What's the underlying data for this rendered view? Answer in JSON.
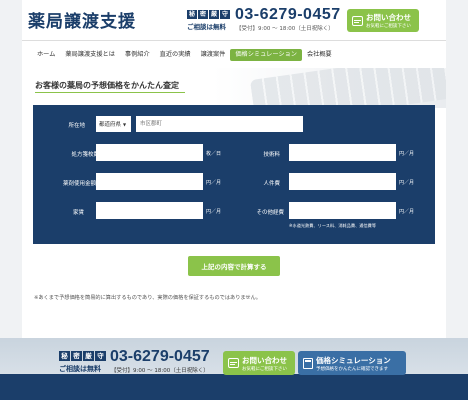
{
  "header": {
    "logo": "薬局譲渡支援",
    "secret_chars": [
      "秘",
      "密",
      "厳",
      "守"
    ],
    "free_consult": "ご相談は無料",
    "tel": "03-6279-0457",
    "hours": "【受付】9:00 〜 18:00（土日祝除く）",
    "contact_label": "お問い合わせ",
    "contact_sub": "お気軽にご相談下さい"
  },
  "nav": {
    "items": [
      {
        "label": "ホーム"
      },
      {
        "label": "薬局譲渡支援とは"
      },
      {
        "label": "事例紹介"
      },
      {
        "label": "直近の実績"
      },
      {
        "label": "譲渡案件"
      },
      {
        "label": "価格シミュレーション",
        "active": true
      },
      {
        "label": "会社概要"
      }
    ]
  },
  "section_title": "お客様の薬局の予想価格をかんたん査定",
  "form": {
    "location_label": "所在地",
    "prefecture_value": "都道府県",
    "city_placeholder": "市区郡町",
    "rx_label": "処方箋枚数",
    "rx_unit": "枚／日",
    "rent_label": "家賃",
    "rent_unit": "円／月",
    "drug_label": "薬剤使用金額",
    "drug_unit": "円／月",
    "labor_label": "人件費",
    "labor_unit": "円／月",
    "tech_label": "技術料",
    "tech_unit": "円／月",
    "other_label": "その他経費",
    "other_unit": "円／月",
    "other_note": "※水道光熱費、リース料、消耗品費、通信費等",
    "submit_label": "上記の内容で計算する"
  },
  "disclaimer": "※あくまで予想価格を簡易的に算出するものであり、実際の価格を保証するものではありません。",
  "footer": {
    "secret_chars": [
      "秘",
      "密",
      "厳",
      "守"
    ],
    "free_consult": "ご相談は無料",
    "tel": "03-6279-0457",
    "hours": "【受付】9:00 〜 18:00（土日祝除く）",
    "contact_label": "お問い合わせ",
    "contact_sub": "お気軽にご相談下さい",
    "sim_label": "価格シミュレーション",
    "sim_sub": "予想価格をかんたんに確認できます"
  },
  "colors": {
    "navy": "#1b3e6a",
    "green": "#8bc34a"
  }
}
